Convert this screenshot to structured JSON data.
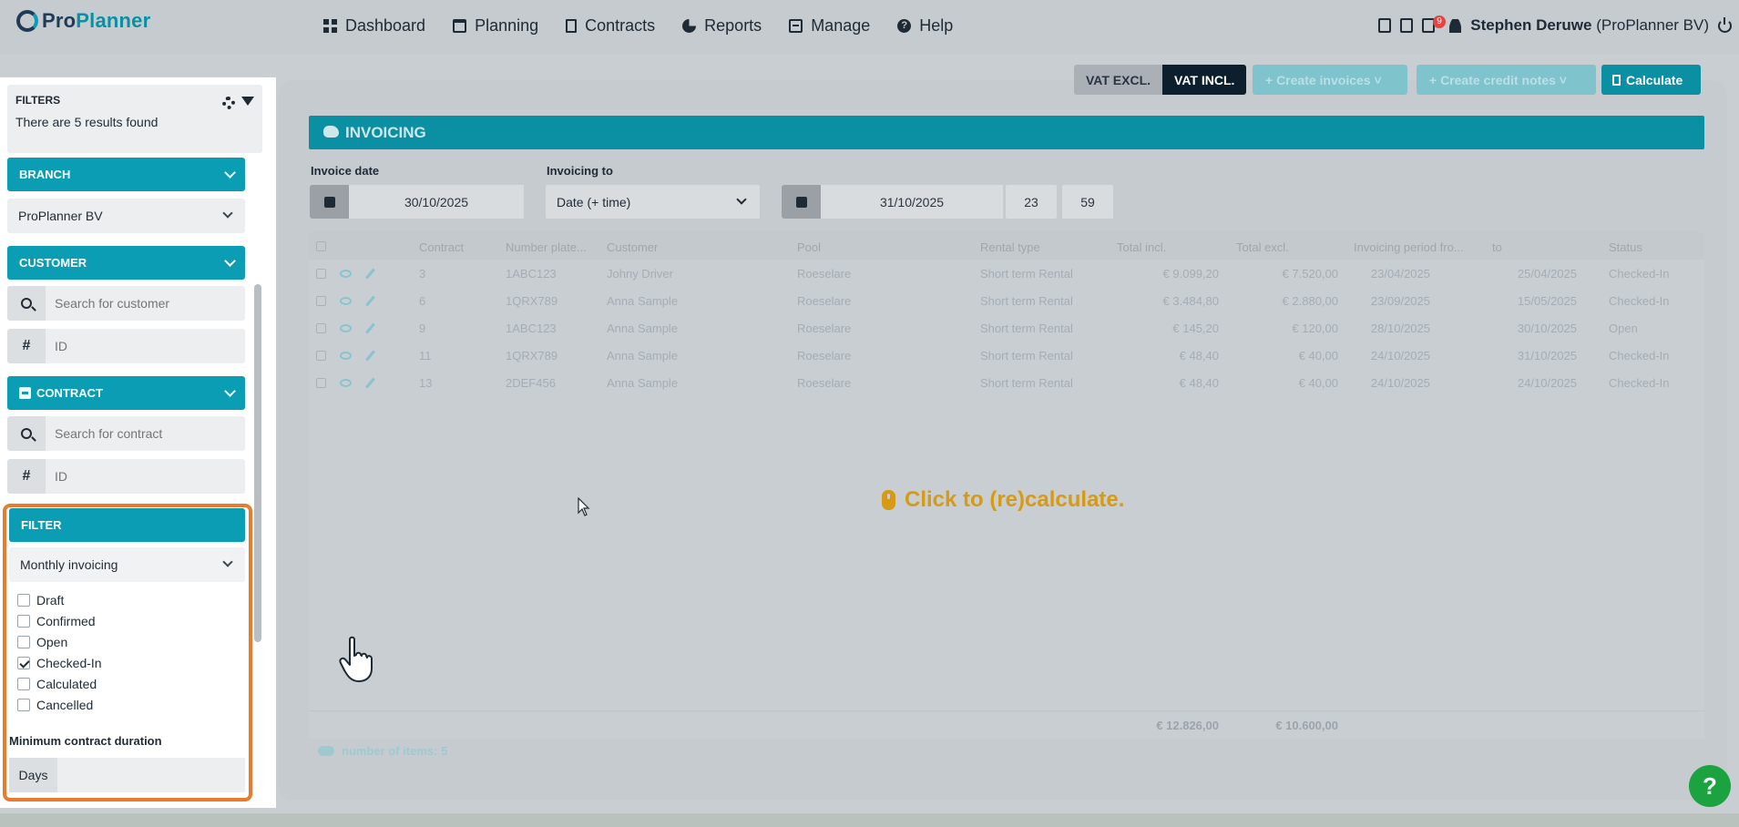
{
  "brand": {
    "name_a": "Pro",
    "name_b": "Planner"
  },
  "nav": [
    {
      "label": "Dashboard",
      "icon": "dashboard-icon"
    },
    {
      "label": "Planning",
      "icon": "calendar-icon"
    },
    {
      "label": "Contracts",
      "icon": "document-icon"
    },
    {
      "label": "Reports",
      "icon": "pie-chart-icon"
    },
    {
      "label": "Manage",
      "icon": "manage-icon"
    },
    {
      "label": "Help",
      "icon": "help-icon"
    }
  ],
  "user": {
    "badge": "9",
    "name": "Stephen Deruwe",
    "company": "(ProPlanner BV)"
  },
  "sidebar": {
    "filters_title": "FILTERS",
    "results_text": "There are 5 results found",
    "branch": {
      "title": "BRANCH",
      "value": "ProPlanner BV"
    },
    "customer": {
      "title": "CUSTOMER",
      "search_placeholder": "Search for customer",
      "id_placeholder": "ID",
      "id_addon": "#"
    },
    "contract": {
      "title": "CONTRACT",
      "search_placeholder": "Search for contract",
      "id_placeholder": "ID",
      "id_addon": "#"
    },
    "filter": {
      "title": "FILTER",
      "period": "Monthly invoicing",
      "statuses": [
        {
          "label": "Draft",
          "checked": false
        },
        {
          "label": "Confirmed",
          "checked": false
        },
        {
          "label": "Open",
          "checked": false
        },
        {
          "label": "Checked-In",
          "checked": true
        },
        {
          "label": "Calculated",
          "checked": false
        },
        {
          "label": "Cancelled",
          "checked": false
        }
      ],
      "min_duration_label": "Minimum contract duration",
      "days_label": "Days"
    }
  },
  "toolbar": {
    "vat_excl": "VAT EXCL.",
    "vat_incl": "VAT INCL.",
    "create_invoices": "+ Create invoices ˅",
    "create_credit_notes": "+ Create credit notes ˅",
    "calculate": "Calculate"
  },
  "invoicing": {
    "title": "INVOICING",
    "invoice_date_label": "Invoice date",
    "invoice_date": "30/10/2025",
    "invoicing_to_label": "Invoicing to",
    "invoicing_to_mode": "Date (+ time)",
    "to_date": "31/10/2025",
    "to_hour": "23",
    "to_minute": "59"
  },
  "table": {
    "columns": [
      "Contract",
      "Number plate...",
      "Customer",
      "Pool",
      "Rental type",
      "Total incl.",
      "Total excl.",
      "Invoicing period fro...",
      "to",
      "Status"
    ],
    "rows": [
      [
        "3",
        "1ABC123",
        "Johny Driver",
        "Roeselare",
        "Short term Rental",
        "€ 9.099,20",
        "€ 7.520,00",
        "23/04/2025",
        "25/04/2025",
        "Checked-In"
      ],
      [
        "6",
        "1QRX789",
        "Anna Sample",
        "Roeselare",
        "Short term Rental",
        "€ 3.484,80",
        "€ 2.880,00",
        "23/09/2025",
        "15/05/2025",
        "Checked-In"
      ],
      [
        "9",
        "1ABC123",
        "Anna Sample",
        "Roeselare",
        "Short term Rental",
        "€ 145,20",
        "€ 120,00",
        "28/10/2025",
        "30/10/2025",
        "Open"
      ],
      [
        "11",
        "1QRX789",
        "Anna Sample",
        "Roeselare",
        "Short term Rental",
        "€ 48,40",
        "€ 40,00",
        "24/10/2025",
        "31/10/2025",
        "Checked-In"
      ],
      [
        "13",
        "2DEF456",
        "Anna Sample",
        "Roeselare",
        "Short term Rental",
        "€ 48,40",
        "€ 40,00",
        "24/10/2025",
        "24/10/2025",
        "Checked-In"
      ]
    ],
    "total_incl": "€ 12.826,00",
    "total_excl": "€ 10.600,00",
    "item_count": "number of items: 5",
    "recalc_text": "Click to (re)calculate."
  },
  "help_fab": "?"
}
